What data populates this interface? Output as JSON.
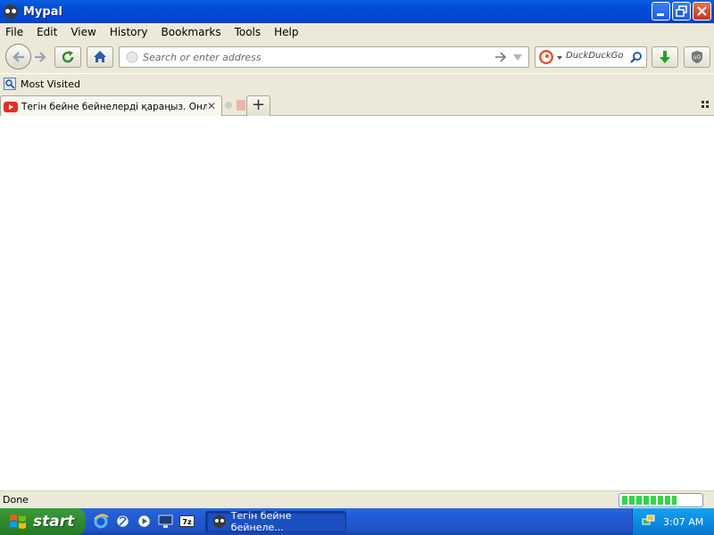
{
  "window": {
    "title": "Mypal"
  },
  "menu": {
    "file": "File",
    "edit": "Edit",
    "view": "View",
    "history": "History",
    "bookmarks": "Bookmarks",
    "tools": "Tools",
    "help": "Help"
  },
  "urlbar": {
    "placeholder": "Search or enter address"
  },
  "search": {
    "engine": "DuckDuckGo"
  },
  "bookmarks_bar": {
    "most_visited": "Most Visited"
  },
  "tabs": [
    {
      "title": "Тегін бейне бейнелерді қараңыз. Онла...",
      "icon": "youtube-icon"
    }
  ],
  "status": {
    "text": "Done",
    "progress": 0.7
  },
  "taskbar": {
    "start": "start",
    "task_button": "Тегін бейне бейнеле...",
    "clock": "3:07 AM"
  },
  "colors": {
    "accent": "#0a5fe0",
    "chrome": "#ece9d8",
    "taskbar": "#245edb",
    "start": "#3c9a3c"
  }
}
